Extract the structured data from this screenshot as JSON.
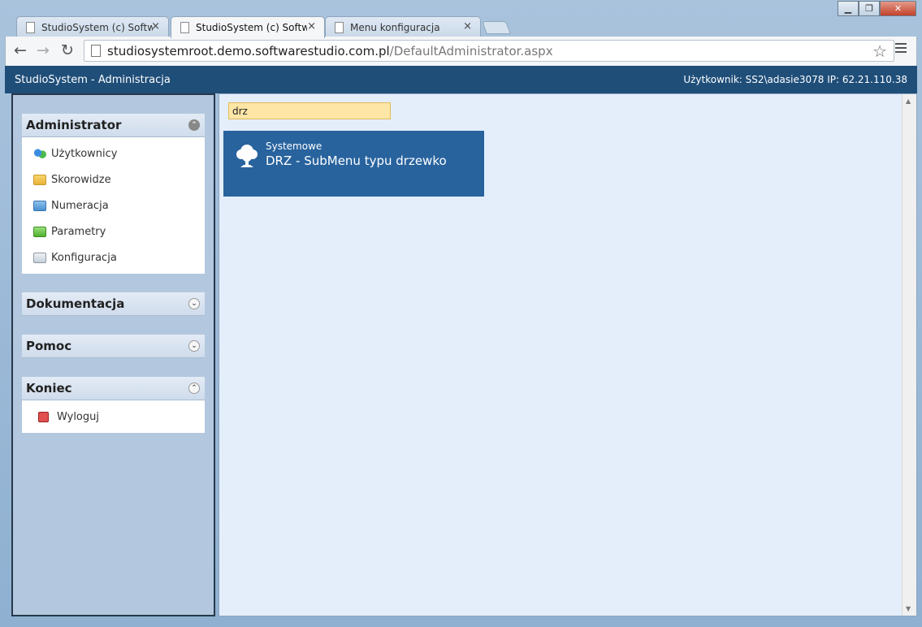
{
  "browser": {
    "tabs": [
      {
        "title": "StudioSystem (c) Software",
        "active": false
      },
      {
        "title": "StudioSystem (c) Software",
        "active": true
      },
      {
        "title": "Menu konfiguracja",
        "active": false
      }
    ],
    "close_glyph": "×",
    "url_host": "studiosystemroot.demo.softwarestudio.com.pl",
    "url_path": "/DefaultAdministrator.aspx",
    "back_glyph": "←",
    "forward_glyph": "→",
    "reload_glyph": "↻",
    "star_glyph": "☆"
  },
  "app": {
    "title": "StudioSystem - Administracja",
    "user_info": "Użytkownik: SS2\\adasie3078 IP: 62.21.110.38",
    "accent_color": "#1f4e79"
  },
  "sidebar": {
    "panels": [
      {
        "title": "Administrator",
        "expanded": true,
        "items": [
          {
            "label": "Użytkownicy",
            "icon": "users-icon"
          },
          {
            "label": "Skorowidze",
            "icon": "folder-yellow-icon"
          },
          {
            "label": "Numeracja",
            "icon": "folder-blue-icon"
          },
          {
            "label": "Parametry",
            "icon": "folder-green-icon"
          },
          {
            "label": "Konfiguracja",
            "icon": "folder-gray-icon"
          }
        ]
      },
      {
        "title": "Dokumentacja",
        "expanded": false,
        "items": []
      },
      {
        "title": "Pomoc",
        "expanded": false,
        "items": []
      },
      {
        "title": "Koniec",
        "expanded": true,
        "items": [
          {
            "label": "Wyloguj",
            "icon": "logout-icon"
          }
        ]
      }
    ]
  },
  "main": {
    "search_value": "drz",
    "tiles": [
      {
        "category": "Systemowe",
        "title": "DRZ - SubMenu typu drzewko",
        "icon": "tree-icon",
        "color": "#28639e"
      }
    ]
  }
}
